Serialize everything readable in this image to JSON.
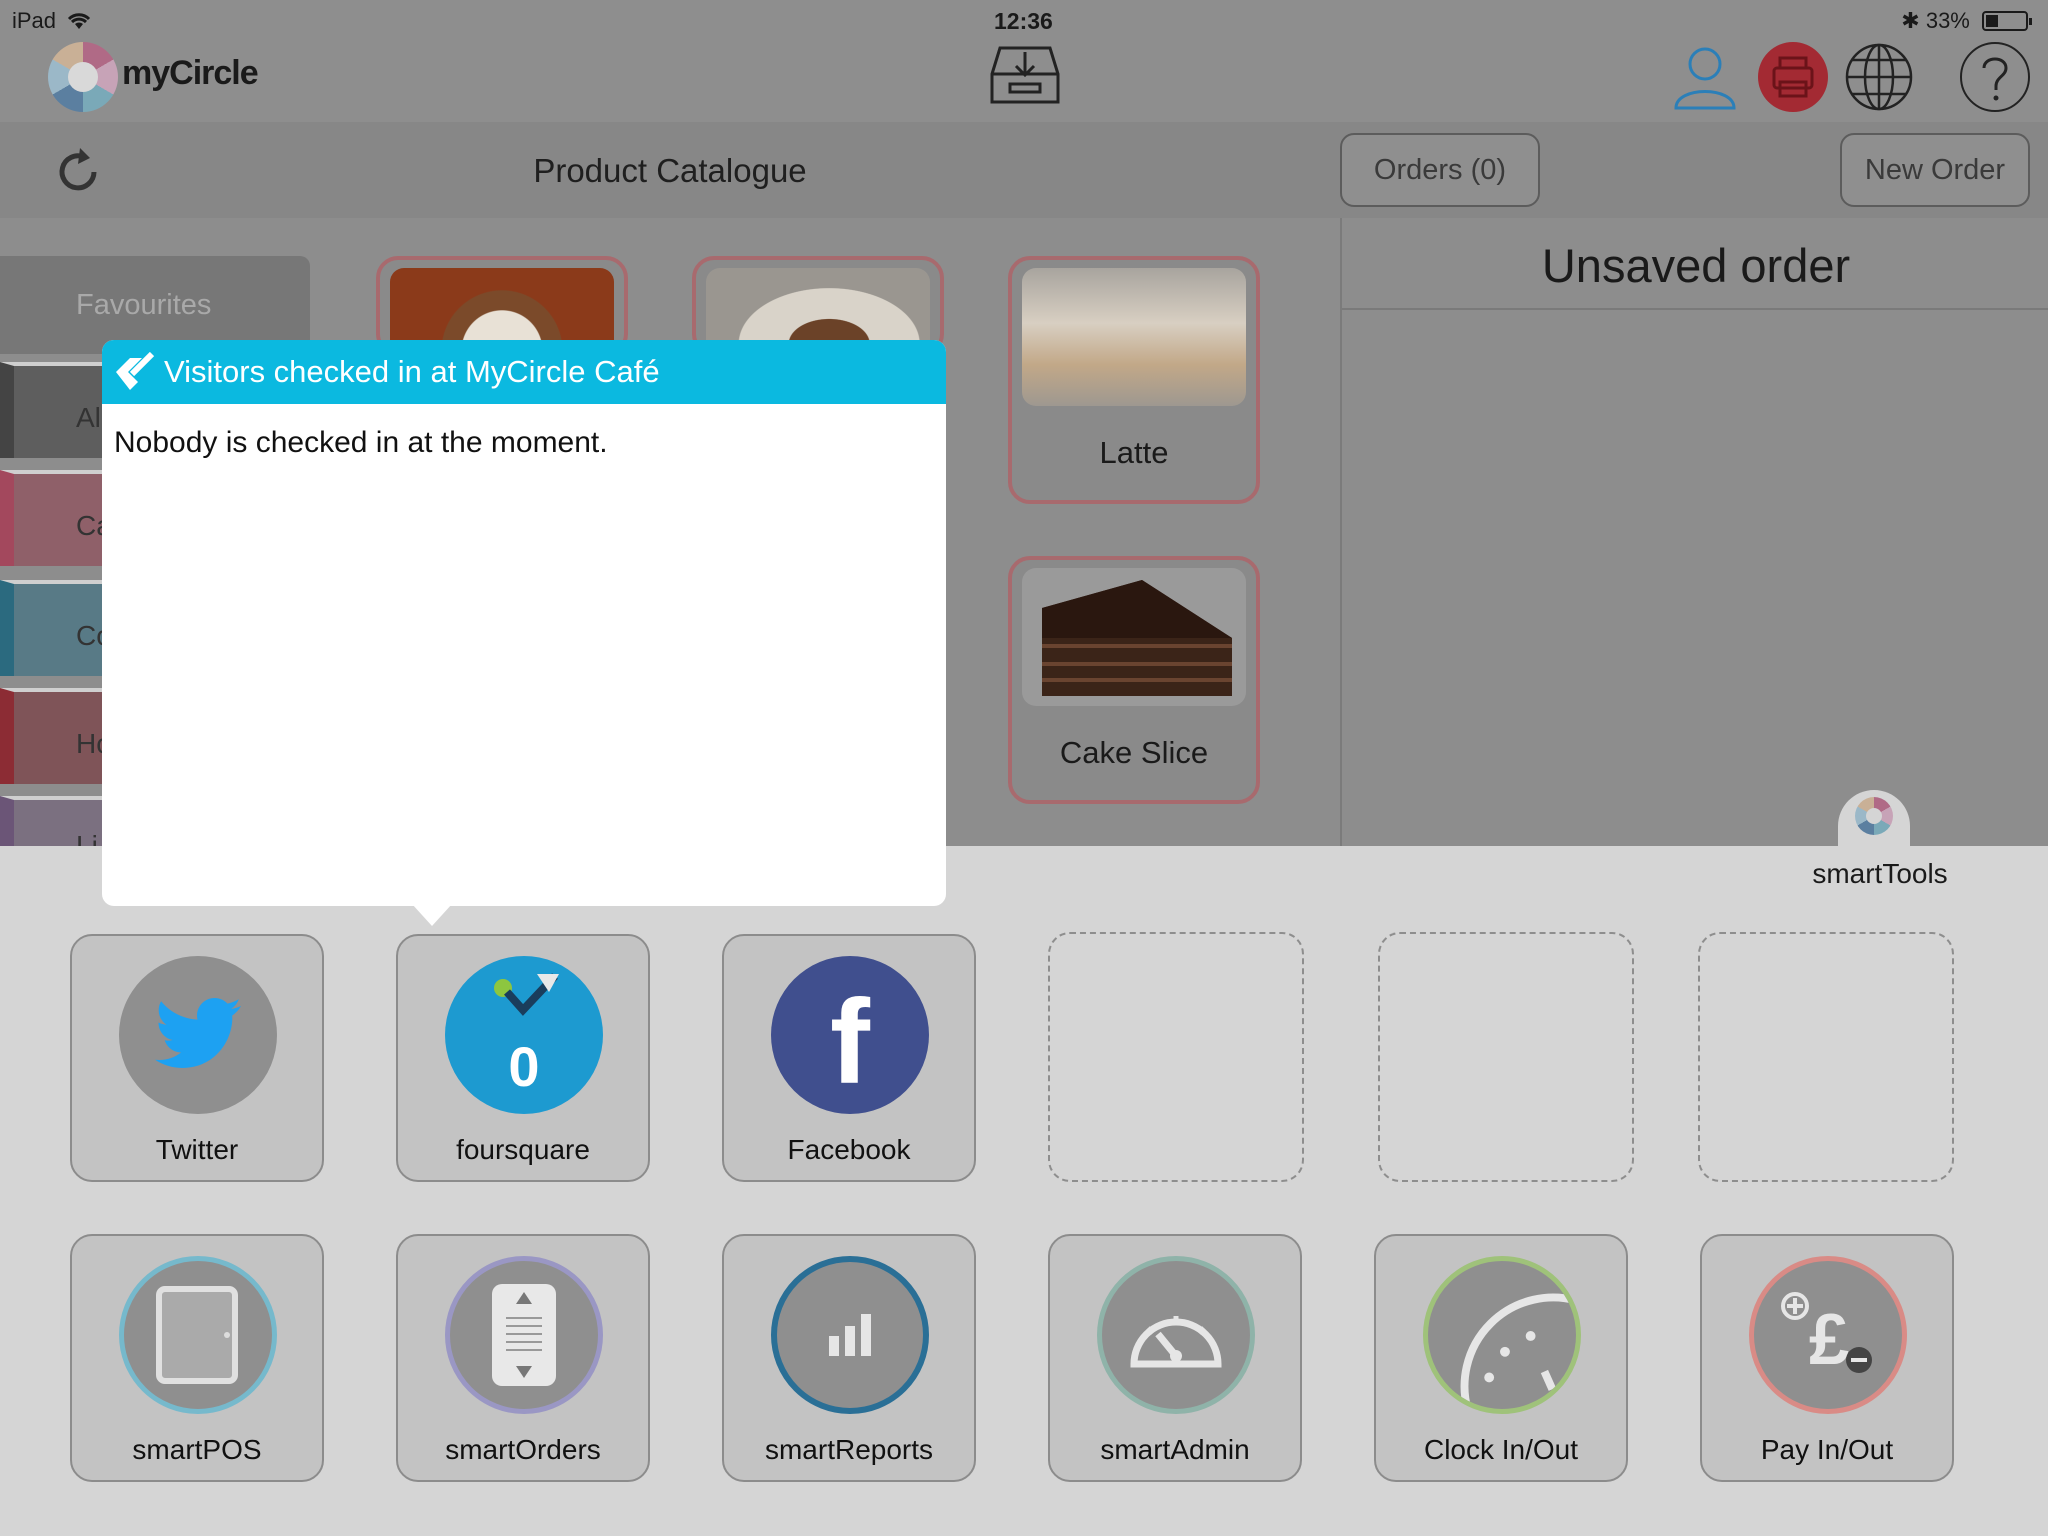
{
  "status_bar": {
    "device": "iPad",
    "time": "12:36",
    "battery": "33%"
  },
  "app": {
    "logo_text": "myCircle"
  },
  "header": {
    "title": "Product Catalogue",
    "orders_button": "Orders (0)",
    "new_order_button": "New Order"
  },
  "categories": {
    "favourites": "Favourites",
    "items": [
      "Al",
      "Ca",
      "Co",
      "Ho",
      "Li"
    ]
  },
  "products": [
    {
      "name": "Latte"
    },
    {
      "name": "Cake Slice"
    }
  ],
  "order_panel": {
    "title": "Unsaved order"
  },
  "popover": {
    "title": "Visitors checked in at MyCircle Café",
    "message": "Nobody is checked in at the moment."
  },
  "smart_tools": {
    "label": "smartTools",
    "row1": [
      {
        "name": "Twitter",
        "icon": "twitter-icon",
        "color": "#1da1f2"
      },
      {
        "name": "foursquare",
        "icon": "foursquare-icon",
        "count": "0",
        "color": "#21a0d8"
      },
      {
        "name": "Facebook",
        "icon": "facebook-icon",
        "color": "#3b5998"
      }
    ],
    "row2": [
      {
        "name": "smartPOS",
        "icon": "tablet-icon",
        "ring": "#76b9cc"
      },
      {
        "name": "smartOrders",
        "icon": "orders-icon",
        "ring": "#9a97c4"
      },
      {
        "name": "smartReports",
        "icon": "bar-chart-icon",
        "ring": "#2a6f96"
      },
      {
        "name": "smartAdmin",
        "icon": "gauge-icon",
        "ring": "#8fb3a9"
      },
      {
        "name": "Clock In/Out",
        "icon": "clock-icon",
        "ring": "#9fc27a"
      },
      {
        "name": "Pay In/Out",
        "icon": "pound-icon",
        "ring": "#d98b86"
      }
    ]
  }
}
